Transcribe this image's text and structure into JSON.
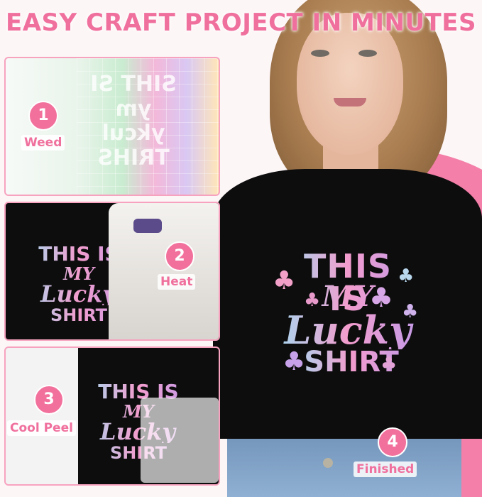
{
  "title": "EASY CRAFT PROJECT IN MINUTES",
  "shirt_graphic": {
    "line1": "THIS IS",
    "line2": "MY",
    "line3": "Lucky",
    "line4": "SHIRT"
  },
  "steps": [
    {
      "number": "1",
      "label": "Weed",
      "mirror_text": [
        "SIHT SI",
        "ym",
        "ykcul",
        "TRIHS"
      ]
    },
    {
      "number": "2",
      "label": "Heat"
    },
    {
      "number": "3",
      "label": "Cool Peel"
    },
    {
      "number": "4",
      "label": "Finished"
    }
  ],
  "colors": {
    "accent": "#f0709d",
    "badge": "#f2709c",
    "shirt": "#0d0d0e",
    "backdrop": "#f47fa8"
  },
  "icons": [
    "clover-icon"
  ]
}
